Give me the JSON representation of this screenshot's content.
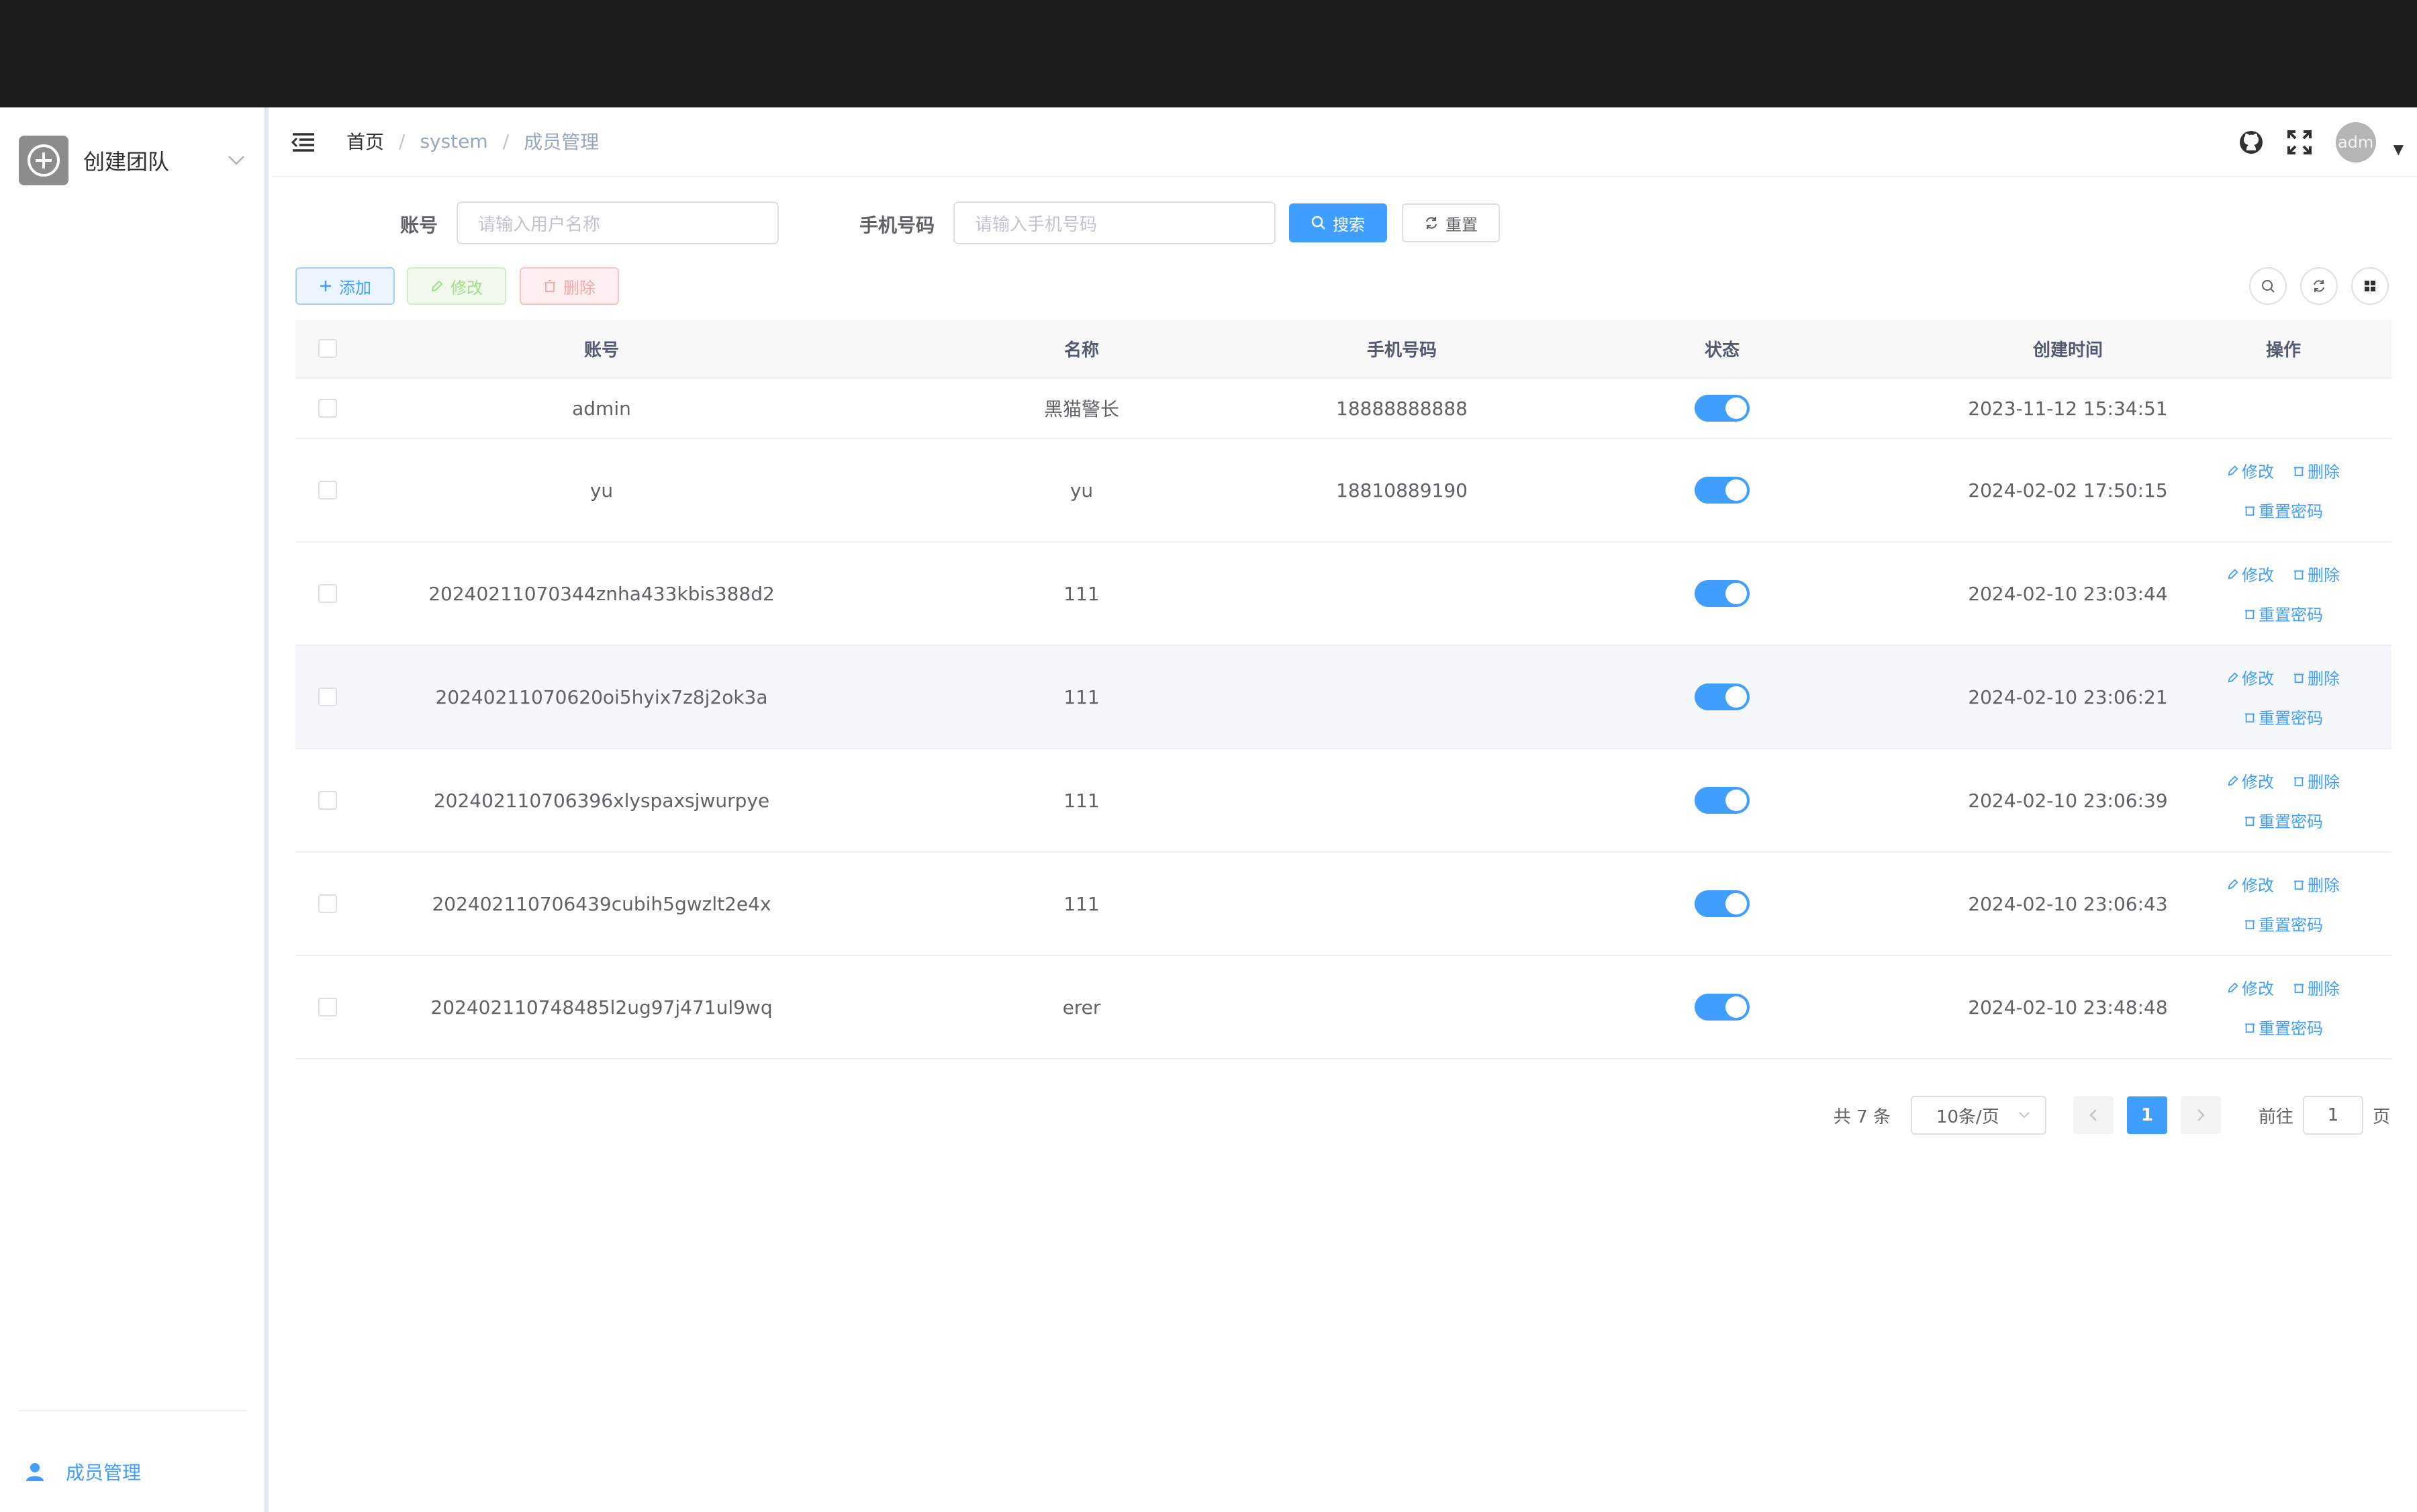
{
  "sidebar": {
    "team_name": "创建团队",
    "menu_item": "成员管理"
  },
  "navbar": {
    "breadcrumb": [
      "首页",
      "system",
      "成员管理"
    ],
    "avatar_text": "adm"
  },
  "search": {
    "account_label": "账号",
    "account_placeholder": "请输入用户名称",
    "phone_label": "手机号码",
    "phone_placeholder": "请输入手机号码",
    "search_label": "搜索",
    "reset_label": "重置"
  },
  "toolbar": {
    "add_label": "添加",
    "edit_label": "修改",
    "delete_label": "删除"
  },
  "table": {
    "headers": [
      "账号",
      "名称",
      "手机号码",
      "状态",
      "创建时间",
      "操作"
    ],
    "ops": {
      "edit": "修改",
      "delete": "删除",
      "reset_pwd": "重置密码"
    },
    "rows": [
      {
        "account": "admin",
        "name": "黑猫警长",
        "phone": "18888888888",
        "time": "2023-11-12 15:34:51",
        "status": true
      },
      {
        "account": "yu",
        "name": "yu",
        "phone": "18810889190",
        "time": "2024-02-02 17:50:15",
        "status": true
      },
      {
        "account": "20240211070344znha433kbis388d2",
        "name": "111",
        "phone": "",
        "time": "2024-02-10 23:03:44",
        "status": true
      },
      {
        "account": "20240211070620oi5hyix7z8j2ok3a",
        "name": "111",
        "phone": "",
        "time": "2024-02-10 23:06:21",
        "status": true
      },
      {
        "account": "202402110706396xlyspaxsjwurpye",
        "name": "111",
        "phone": "",
        "time": "2024-02-10 23:06:39",
        "status": true
      },
      {
        "account": "202402110706439cubih5gwzlt2e4x",
        "name": "111",
        "phone": "",
        "time": "2024-02-10 23:06:43",
        "status": true
      },
      {
        "account": "202402110748485l2ug97j471ul9wq",
        "name": "erer",
        "phone": "",
        "time": "2024-02-10 23:48:48",
        "status": true
      }
    ]
  },
  "pagination": {
    "total": "共 7 条",
    "page_size": "10条/页",
    "current": "1",
    "goto_label": "前往",
    "goto_value": "1",
    "page_unit": "页"
  },
  "colors": {
    "primary": "#409eff",
    "topbar": "#1d1d1d"
  }
}
